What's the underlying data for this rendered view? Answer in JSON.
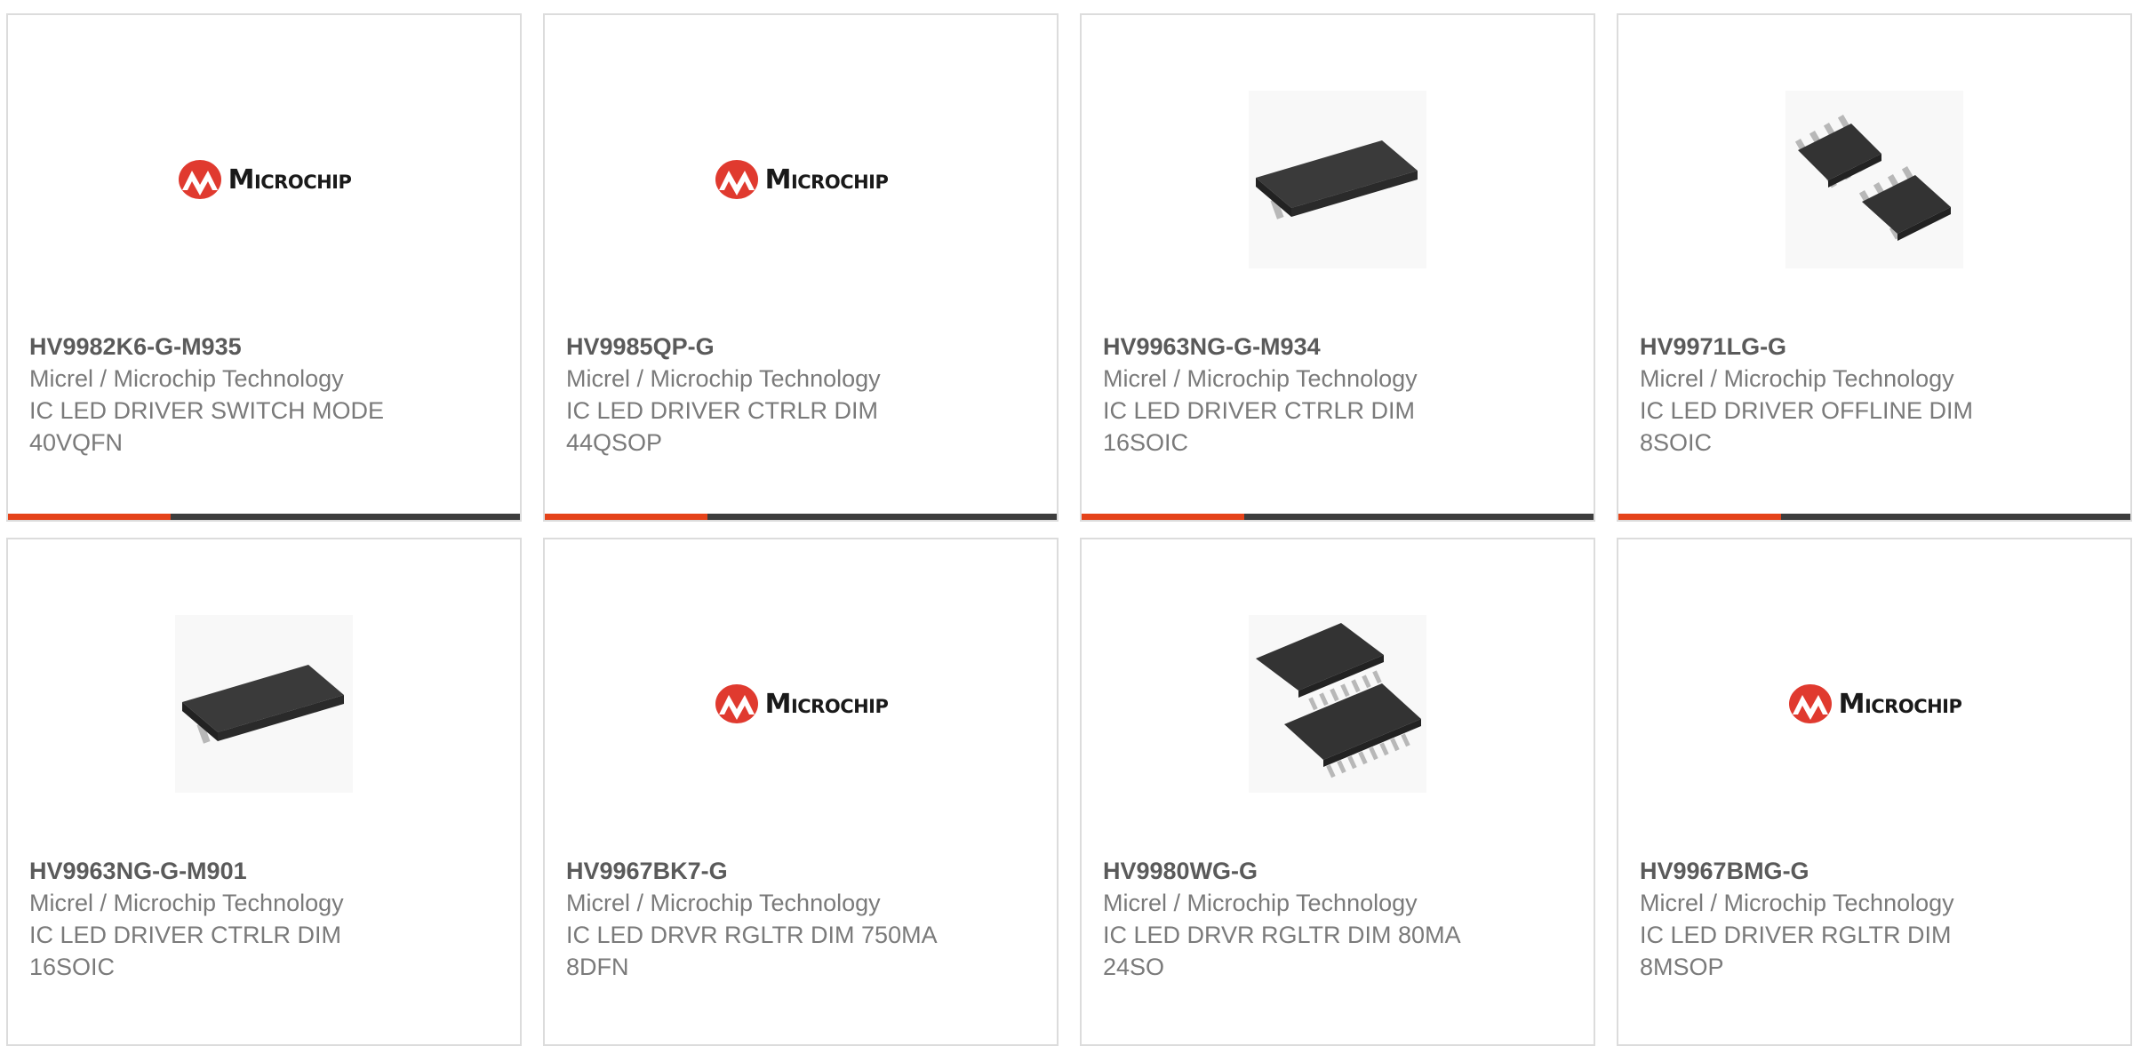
{
  "colors": {
    "accent": "#e5431a",
    "bar": "#3d3d3d",
    "border": "#dcdcdc",
    "logo_red": "#e03a2f"
  },
  "products": [
    {
      "part": "HV9982K6-G-M935",
      "manufacturer": "Micrel / Microchip Technology",
      "description": "IC LED DRIVER SWITCH MODE 40VQFN",
      "image": "microchip-logo",
      "logo_text": "Microchip"
    },
    {
      "part": "HV9985QP-G",
      "manufacturer": "Micrel / Microchip Technology",
      "description": "IC LED DRIVER CTRLR DIM 44QSOP",
      "image": "microchip-logo",
      "logo_text": "Microchip"
    },
    {
      "part": "HV9963NG-G-M934",
      "manufacturer": "Micrel / Microchip Technology",
      "description": "IC LED DRIVER CTRLR DIM 16SOIC",
      "image": "soic-16-chip-photo"
    },
    {
      "part": "HV9971LG-G",
      "manufacturer": "Micrel / Microchip Technology",
      "description": "IC LED DRIVER OFFLINE DIM 8SOIC",
      "image": "soic-8-two-chips-photo"
    },
    {
      "part": "HV9963NG-G-M901",
      "manufacturer": "Micrel / Microchip Technology",
      "description": "IC LED DRIVER CTRLR DIM 16SOIC",
      "image": "soic-16-chip-photo"
    },
    {
      "part": "HV9967BK7-G",
      "manufacturer": "Micrel / Microchip Technology",
      "description": "IC LED DRVR RGLTR DIM 750MA 8DFN",
      "image": "microchip-logo",
      "logo_text": "Microchip"
    },
    {
      "part": "HV9980WG-G",
      "manufacturer": "Micrel / Microchip Technology",
      "description": "IC LED DRVR RGLTR DIM 80MA 24SO",
      "image": "so-24-two-chips-photo"
    },
    {
      "part": "HV9967BMG-G",
      "manufacturer": "Micrel / Microchip Technology",
      "description": "IC LED DRIVER RGLTR DIM 8MSOP",
      "image": "microchip-logo",
      "logo_text": "Microchip"
    }
  ]
}
